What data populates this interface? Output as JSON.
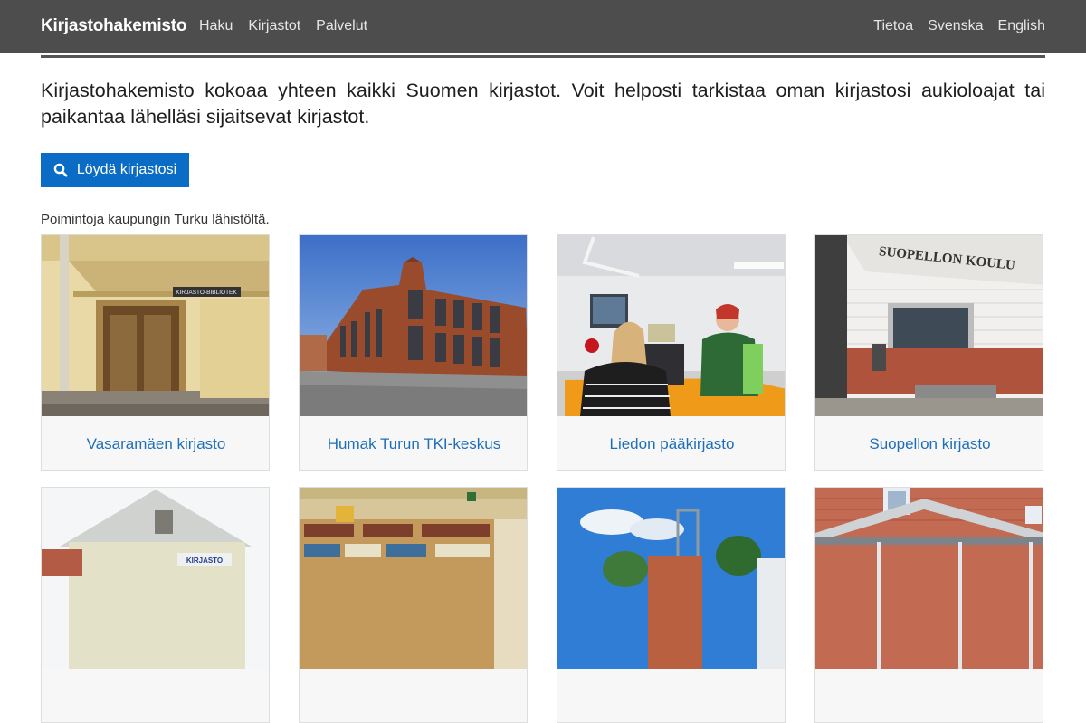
{
  "navbar": {
    "brand": "Kirjastohakemisto",
    "left_links": [
      "Haku",
      "Kirjastot",
      "Palvelut"
    ],
    "right_links": [
      "Tietoa",
      "Svenska",
      "English"
    ]
  },
  "intro": "Kirjastohakemisto kokoaa yhteen kaikki Suomen kirjastot. Voit helposti tarkistaa oman kirjastosi aukioloajat tai paikantaa lähelläsi sijaitsevat kirjastot.",
  "find_button": {
    "label": "Löydä kirjastosi",
    "icon": "search-icon"
  },
  "picks_label": "Poimintoja kaupungin Turku lähistöltä.",
  "libraries": [
    {
      "name": "Vasaramäen kirjasto",
      "sign": "KIRJASTO-BIBLIOTEK"
    },
    {
      "name": "Humak Turun TKI-keskus"
    },
    {
      "name": "Liedon pääkirjasto"
    },
    {
      "name": "Suopellon kirjasto",
      "sign": "SUOPELLON KOULU"
    }
  ],
  "second_row_signs": [
    "KIRJASTO"
  ],
  "colors": {
    "navbar": "#4d4d4d",
    "button": "#0a6cc4",
    "link": "#1f6fb8"
  }
}
